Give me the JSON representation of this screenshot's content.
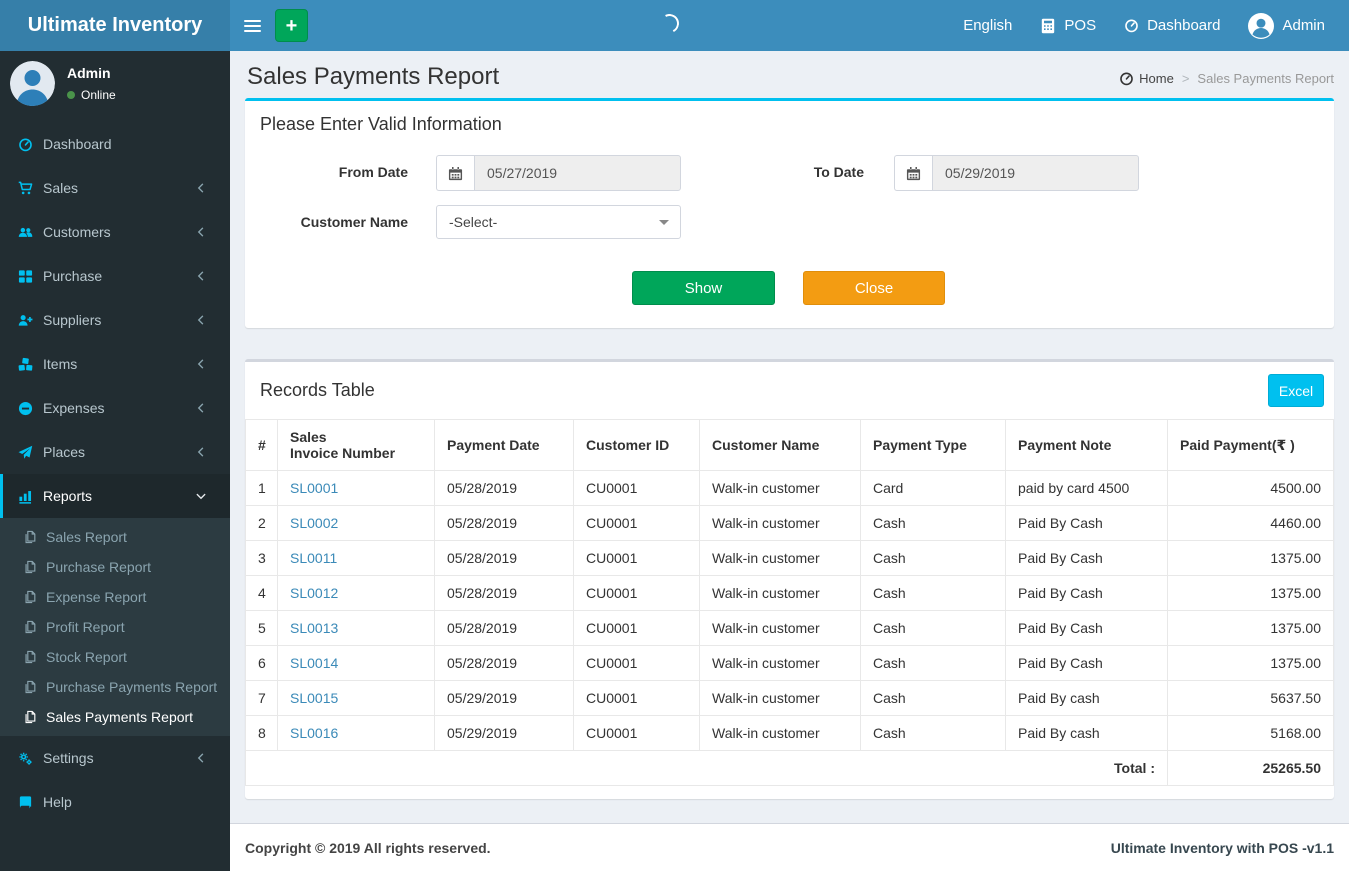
{
  "app": {
    "title": "Ultimate Inventory",
    "copyright": "Copyright © 2019 All rights reserved.",
    "version_label": "Ultimate Inventory with POS -v1.1"
  },
  "topnav": {
    "language": "English",
    "pos_label": "POS",
    "dashboard_label": "Dashboard",
    "user_label": "Admin"
  },
  "user_panel": {
    "name": "Admin",
    "status": "Online"
  },
  "sidebar": {
    "items": [
      {
        "label": "Dashboard",
        "icon": "tachometer-icon"
      },
      {
        "label": "Sales",
        "icon": "cart-icon",
        "chevron": "left"
      },
      {
        "label": "Customers",
        "icon": "users-icon",
        "chevron": "left"
      },
      {
        "label": "Purchase",
        "icon": "grid-icon",
        "chevron": "left"
      },
      {
        "label": "Suppliers",
        "icon": "user-plus-icon",
        "chevron": "left"
      },
      {
        "label": "Items",
        "icon": "cubes-icon",
        "chevron": "left"
      },
      {
        "label": "Expenses",
        "icon": "minus-circle-icon",
        "chevron": "left"
      },
      {
        "label": "Places",
        "icon": "paper-plane-icon",
        "chevron": "left"
      },
      {
        "label": "Reports",
        "icon": "bar-chart-icon",
        "chevron": "down",
        "active": true,
        "submenu": [
          {
            "label": "Sales Report"
          },
          {
            "label": "Purchase Report"
          },
          {
            "label": "Expense Report"
          },
          {
            "label": "Profit Report"
          },
          {
            "label": "Stock Report"
          },
          {
            "label": "Purchase Payments Report"
          },
          {
            "label": "Sales Payments Report",
            "active": true
          }
        ]
      },
      {
        "label": "Settings",
        "icon": "gears-icon",
        "chevron": "left"
      },
      {
        "label": "Help",
        "icon": "book-icon"
      }
    ]
  },
  "page": {
    "title": "Sales Payments Report",
    "breadcrumb_home": "Home",
    "breadcrumb_current": "Sales Payments Report"
  },
  "filter": {
    "heading": "Please Enter Valid Information",
    "from_date_label": "From Date",
    "from_date_value": "05/27/2019",
    "to_date_label": "To Date",
    "to_date_value": "05/29/2019",
    "customer_label": "Customer Name",
    "customer_value": "-Select-",
    "show_label": "Show",
    "close_label": "Close"
  },
  "records": {
    "heading": "Records Table",
    "excel_label": "Excel",
    "columns": [
      "#",
      "Sales\nInvoice Number",
      "Payment Date",
      "Customer ID",
      "Customer Name",
      "Payment Type",
      "Payment Note",
      "Paid Payment(₹ )"
    ],
    "rows": [
      [
        "1",
        "SL0001",
        "05/28/2019",
        "CU0001",
        "Walk-in customer",
        "Card",
        "paid by card 4500",
        "4500.00"
      ],
      [
        "2",
        "SL0002",
        "05/28/2019",
        "CU0001",
        "Walk-in customer",
        "Cash",
        "Paid By Cash",
        "4460.00"
      ],
      [
        "3",
        "SL0011",
        "05/28/2019",
        "CU0001",
        "Walk-in customer",
        "Cash",
        "Paid By Cash",
        "1375.00"
      ],
      [
        "4",
        "SL0012",
        "05/28/2019",
        "CU0001",
        "Walk-in customer",
        "Cash",
        "Paid By Cash",
        "1375.00"
      ],
      [
        "5",
        "SL0013",
        "05/28/2019",
        "CU0001",
        "Walk-in customer",
        "Cash",
        "Paid By Cash",
        "1375.00"
      ],
      [
        "6",
        "SL0014",
        "05/28/2019",
        "CU0001",
        "Walk-in customer",
        "Cash",
        "Paid By Cash",
        "1375.00"
      ],
      [
        "7",
        "SL0015",
        "05/29/2019",
        "CU0001",
        "Walk-in customer",
        "Cash",
        "Paid By cash",
        "5637.50"
      ],
      [
        "8",
        "SL0016",
        "05/29/2019",
        "CU0001",
        "Walk-in customer",
        "Cash",
        "Paid By cash",
        "5168.00"
      ]
    ],
    "total_label": "Total :",
    "total_value": "25265.50"
  },
  "colors": {
    "navbar_blue": "#3c8dbc",
    "logo_blue": "#367fa9",
    "sidebar_dark": "#222d32",
    "submenu_dark": "#2c3b41",
    "accent_cyan": "#00c0ef",
    "success_green": "#00a65a",
    "warning_orange": "#f39c12",
    "online_green": "#4a934a",
    "link_blue": "#3b8ab8"
  }
}
